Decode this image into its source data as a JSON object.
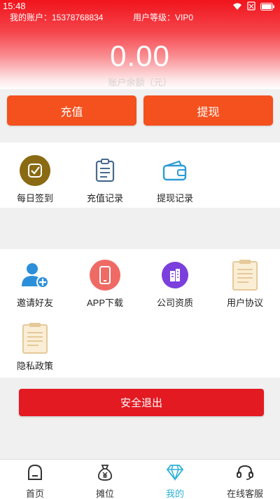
{
  "status_bar": {
    "time": "15:48"
  },
  "header": {
    "account_label": "我的账户：15378768834",
    "level_label": "用户等级：VIP0",
    "balance": "0.00",
    "balance_caption": "账户余额（元）"
  },
  "actions": {
    "recharge": "充值",
    "withdraw": "提现"
  },
  "quick_menu": [
    {
      "label": "每日签到",
      "icon": "checkin-icon"
    },
    {
      "label": "充值记录",
      "icon": "clipboard-icon"
    },
    {
      "label": "提现记录",
      "icon": "wallet-icon"
    }
  ],
  "more_menu": [
    {
      "label": "邀请好友",
      "icon": "add-user-icon"
    },
    {
      "label": "APP下载",
      "icon": "phone-icon"
    },
    {
      "label": "公司资质",
      "icon": "building-icon"
    },
    {
      "label": "用户协议",
      "icon": "document-icon"
    },
    {
      "label": "隐私政策",
      "icon": "document-icon"
    }
  ],
  "logout_label": "安全退出",
  "tabbar": [
    {
      "label": "首页",
      "icon": "home-icon"
    },
    {
      "label": "摊位",
      "icon": "money-bag-icon"
    },
    {
      "label": "我的",
      "icon": "diamond-icon",
      "active": true
    },
    {
      "label": "在线客服",
      "icon": "headset-icon"
    }
  ],
  "colors": {
    "primary_red": "#e31a22",
    "action_orange": "#f4511e",
    "active_tab": "#2fb0d6"
  }
}
